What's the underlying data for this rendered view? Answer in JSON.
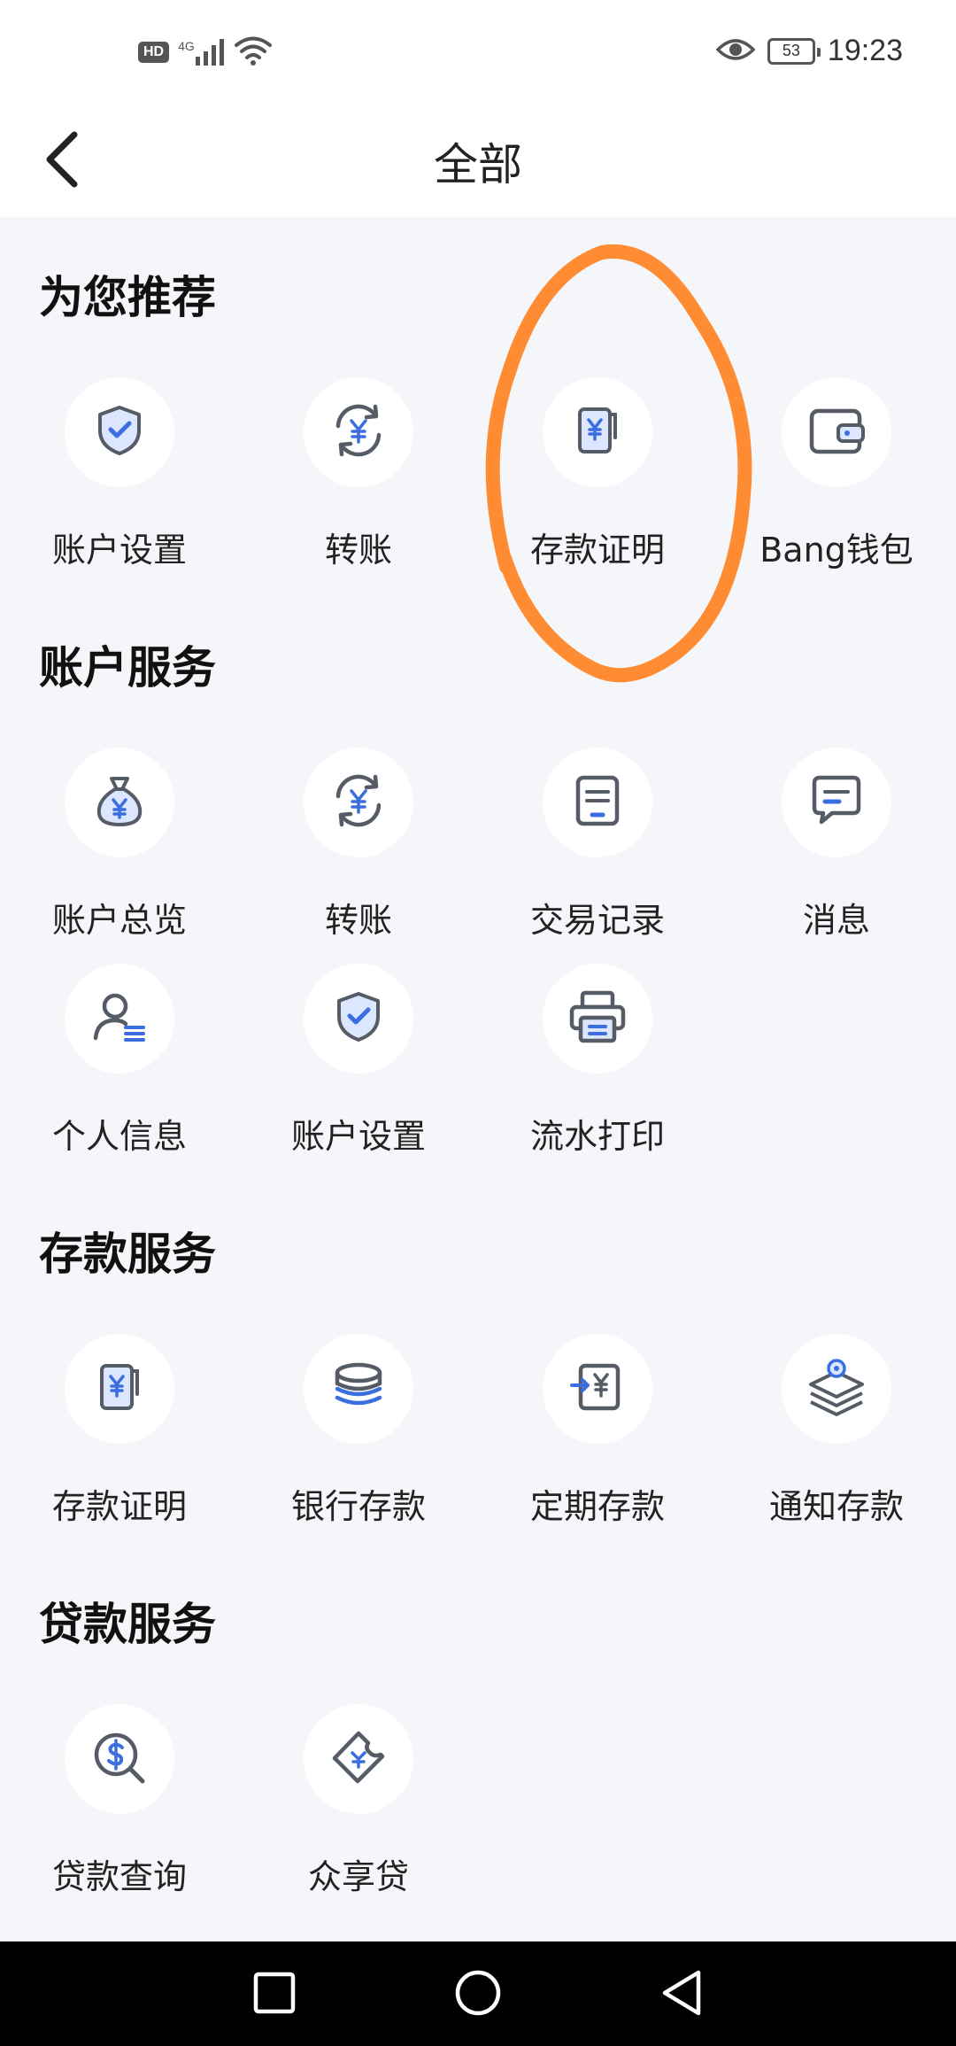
{
  "status_bar": {
    "hd_badge": "HD",
    "network": "4G",
    "battery": "53",
    "time": "19:23"
  },
  "header": {
    "title": "全部",
    "back_icon": "back-arrow-icon"
  },
  "sections": [
    {
      "title": "为您推荐",
      "items": [
        {
          "label": "账户设置",
          "icon": "shield-check-icon"
        },
        {
          "label": "转账",
          "icon": "transfer-yen-icon"
        },
        {
          "label": "存款证明",
          "icon": "deposit-certificate-icon"
        },
        {
          "label": "Bang钱包",
          "icon": "wallet-icon"
        }
      ]
    },
    {
      "title": "账户服务",
      "items": [
        {
          "label": "账户总览",
          "icon": "money-bag-icon"
        },
        {
          "label": "转账",
          "icon": "transfer-yen-icon"
        },
        {
          "label": "交易记录",
          "icon": "transaction-record-icon"
        },
        {
          "label": "消息",
          "icon": "message-icon"
        },
        {
          "label": "个人信息",
          "icon": "person-info-icon"
        },
        {
          "label": "账户设置",
          "icon": "shield-check-icon"
        },
        {
          "label": "流水打印",
          "icon": "printer-icon"
        }
      ]
    },
    {
      "title": "存款服务",
      "items": [
        {
          "label": "存款证明",
          "icon": "deposit-certificate-icon"
        },
        {
          "label": "银行存款",
          "icon": "coin-stack-icon"
        },
        {
          "label": "定期存款",
          "icon": "fixed-deposit-icon"
        },
        {
          "label": "通知存款",
          "icon": "layers-icon"
        }
      ]
    },
    {
      "title": "贷款服务",
      "items": [
        {
          "label": "贷款查询",
          "icon": "loan-search-icon"
        },
        {
          "label": "众享贷",
          "icon": "ticket-icon"
        }
      ]
    }
  ],
  "colors": {
    "accent": "#3b6fe0",
    "icon_stroke": "#555c66",
    "icon_fill": "#dce7ff",
    "annotation": "#ff8c33",
    "background": "#f4f6f9"
  }
}
